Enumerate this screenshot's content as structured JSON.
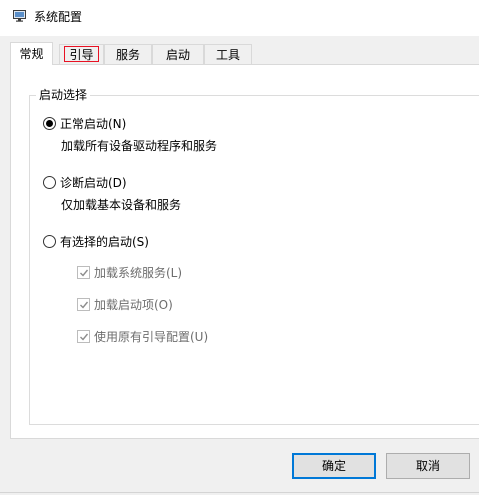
{
  "window": {
    "title": "系统配置",
    "icon": "msconfig-app-icon"
  },
  "tabs": [
    {
      "label": "常规",
      "active": true
    },
    {
      "label": "引导",
      "focused": true
    },
    {
      "label": "服务"
    },
    {
      "label": "启动"
    },
    {
      "label": "工具"
    }
  ],
  "startup_group": {
    "legend": "启动选择",
    "options": [
      {
        "label": "正常启动(N)",
        "selected": true,
        "description": "加载所有设备驱动程序和服务"
      },
      {
        "label": "诊断启动(D)",
        "selected": false,
        "description": "仅加载基本设备和服务"
      },
      {
        "label": "有选择的启动(S)",
        "selected": false
      }
    ],
    "selective_items": [
      {
        "label": "加载系统服务(L)",
        "checked": true,
        "disabled": true
      },
      {
        "label": "加载启动项(O)",
        "checked": true,
        "disabled": true
      },
      {
        "label": "使用原有引导配置(U)",
        "checked": true,
        "disabled": true
      }
    ]
  },
  "buttons": {
    "ok": "确定",
    "cancel": "取消"
  },
  "colors": {
    "focus_outline": "#e81123",
    "default_button_border": "#0078d7",
    "disabled_text": "#6d6d6d"
  }
}
